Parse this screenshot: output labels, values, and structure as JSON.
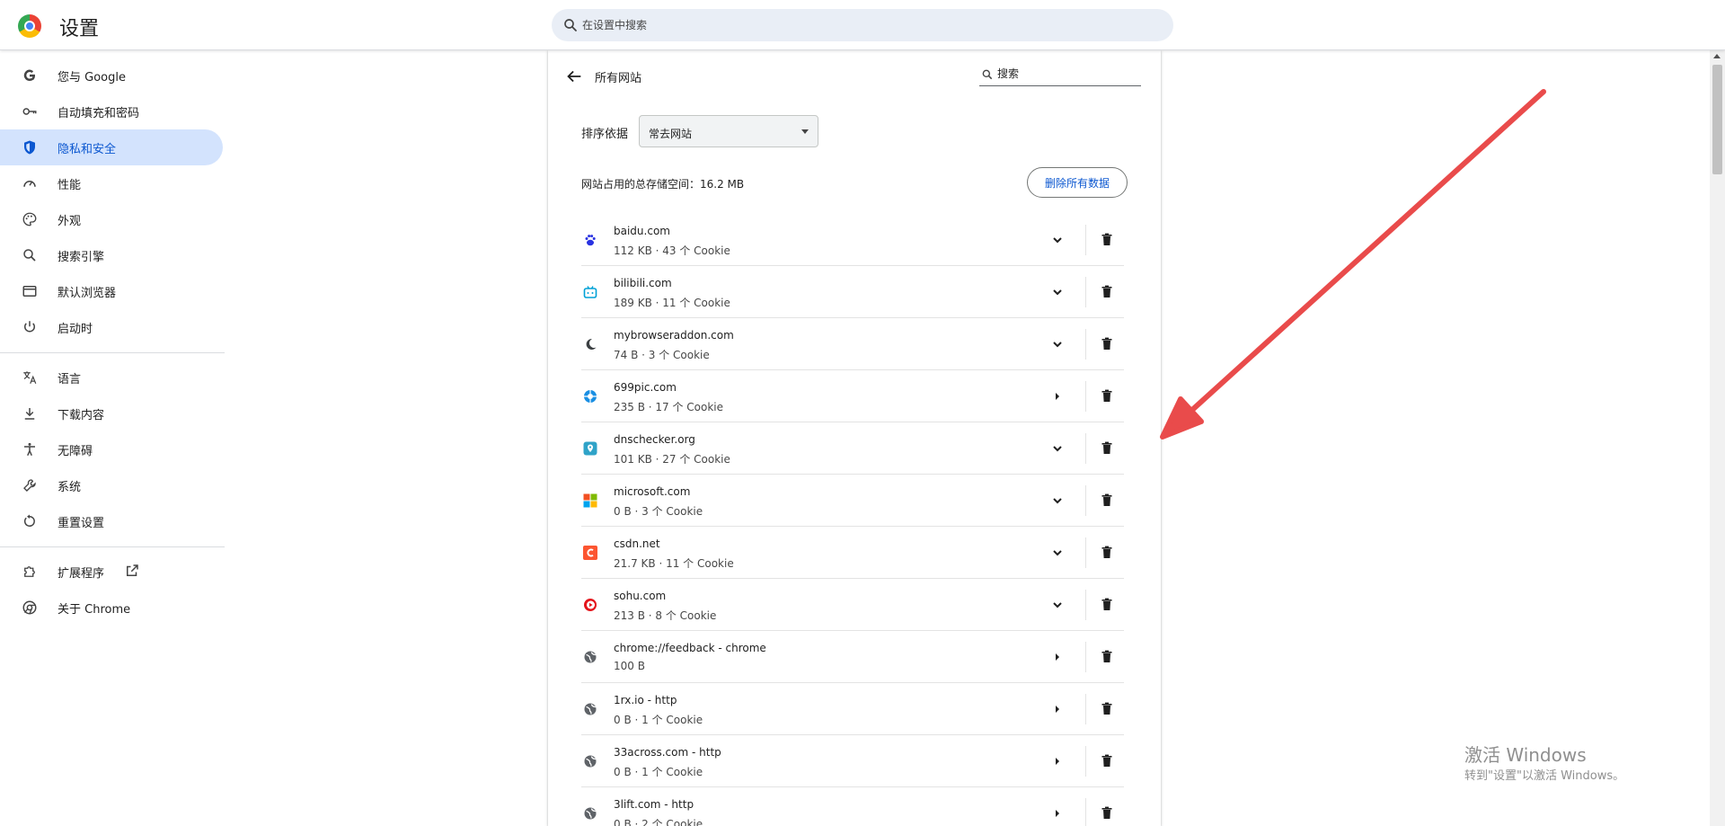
{
  "header": {
    "title": "设置",
    "search_placeholder": "在设置中搜索"
  },
  "sidebar": {
    "items": [
      {
        "label": "您与 Google",
        "icon": "google-g-icon"
      },
      {
        "label": "自动填充和密码",
        "icon": "key-icon"
      },
      {
        "label": "隐私和安全",
        "icon": "shield-icon",
        "active": true
      },
      {
        "label": "性能",
        "icon": "speedometer-icon"
      },
      {
        "label": "外观",
        "icon": "palette-icon"
      },
      {
        "label": "搜索引擎",
        "icon": "search-icon"
      },
      {
        "label": "默认浏览器",
        "icon": "browser-window-icon"
      },
      {
        "label": "启动时",
        "icon": "power-icon"
      },
      {
        "label": "语言",
        "icon": "translate-icon"
      },
      {
        "label": "下载内容",
        "icon": "download-icon"
      },
      {
        "label": "无障碍",
        "icon": "accessibility-icon"
      },
      {
        "label": "系统",
        "icon": "wrench-icon"
      },
      {
        "label": "重置设置",
        "icon": "reset-icon"
      },
      {
        "label": "扩展程序",
        "icon": "puzzle-icon"
      },
      {
        "label": "关于 Chrome",
        "icon": "chrome-icon"
      }
    ]
  },
  "main": {
    "title": "所有网站",
    "search_placeholder": "搜索",
    "sort_label": "排序依据",
    "sort_value": "常去网站",
    "storage_text": "网站占用的总存储空间：16.2 MB",
    "delete_all_label": "删除所有数据",
    "sites": [
      {
        "name": "baidu.com",
        "meta": "112 KB · 43 个 Cookie",
        "favicon": "baidu-paw-icon",
        "expandable": true
      },
      {
        "name": "bilibili.com",
        "meta": "189 KB · 11 个 Cookie",
        "favicon": "bilibili-tv-icon",
        "expandable": true
      },
      {
        "name": "mybrowseraddon.com",
        "meta": "74 B · 3 个 Cookie",
        "favicon": "moon-icon",
        "expandable": true
      },
      {
        "name": "699pic.com",
        "meta": "235 B · 17 个 Cookie",
        "favicon": "aperture-icon",
        "expandable": false
      },
      {
        "name": "dnschecker.org",
        "meta": "101 KB · 27 个 Cookie",
        "favicon": "location-pin-icon",
        "expandable": true
      },
      {
        "name": "microsoft.com",
        "meta": "0 B · 3 个 Cookie",
        "favicon": "microsoft-logo-icon",
        "expandable": true
      },
      {
        "name": "csdn.net",
        "meta": "21.7 KB · 11 个 Cookie",
        "favicon": "csdn-c-icon",
        "expandable": true
      },
      {
        "name": "sohu.com",
        "meta": "213 B · 8 个 Cookie",
        "favicon": "sohu-play-icon",
        "expandable": true
      },
      {
        "name": "chrome://feedback - chrome",
        "meta": "100 B",
        "favicon": "globe-icon",
        "expandable": false
      },
      {
        "name": "1rx.io - http",
        "meta": "0 B · 1 个 Cookie",
        "favicon": "globe-icon",
        "expandable": false
      },
      {
        "name": "33across.com - http",
        "meta": "0 B · 1 个 Cookie",
        "favicon": "globe-icon",
        "expandable": false
      },
      {
        "name": "3lift.com - http",
        "meta": "0 B · 2 个 Cookie",
        "favicon": "globe-icon",
        "expandable": false
      }
    ]
  },
  "watermark": {
    "line1": "激活 Windows",
    "line2": "转到\"设置\"以激活 Windows。"
  },
  "colors": {
    "accent": "#0b57d0",
    "active_bg": "#d3e3fd",
    "annotation_arrow": "#e94b4b"
  }
}
